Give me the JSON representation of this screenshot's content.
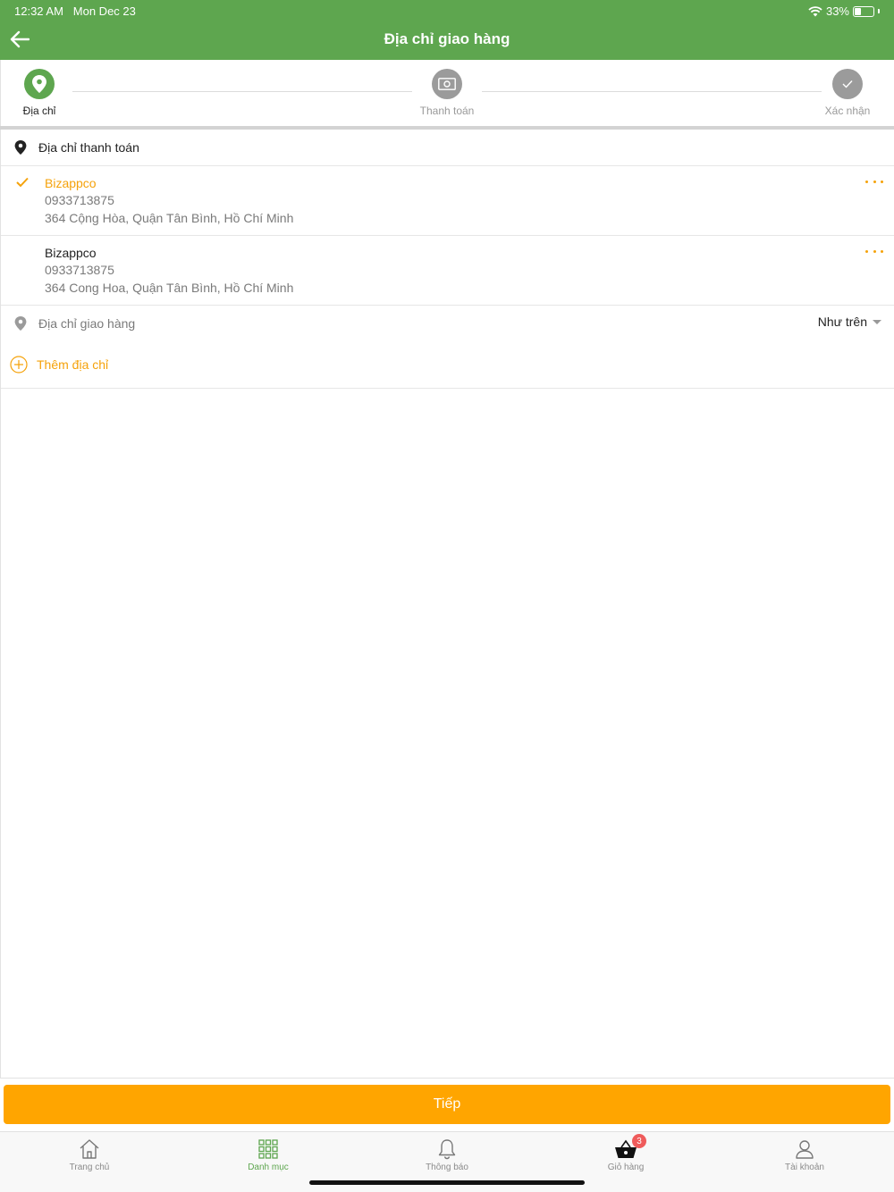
{
  "status_bar": {
    "time": "12:32 AM",
    "date": "Mon Dec 23",
    "battery": "33%",
    "wifi_icon": "wifi-icon"
  },
  "header": {
    "title": "Địa chỉ giao hàng",
    "back_icon": "arrow-left-icon"
  },
  "steps": [
    {
      "label": "Địa chỉ",
      "icon": "location-pin-icon",
      "active": true
    },
    {
      "label": "Thanh toán",
      "icon": "cash-icon",
      "active": false
    },
    {
      "label": "Xác nhận",
      "icon": "checkmark-icon",
      "active": false
    }
  ],
  "billing": {
    "title": "Địa chỉ thanh toán",
    "addresses": [
      {
        "name": "Bizappco",
        "phone": "0933713875",
        "address": "364 Cộng Hòa, Quận Tân Bình, Hồ Chí Minh",
        "selected": true
      },
      {
        "name": "Bizappco",
        "phone": "0933713875",
        "address": "364 Cong Hoa, Quận Tân Bình, Hồ Chí Minh",
        "selected": false
      }
    ]
  },
  "shipping": {
    "label": "Địa chỉ giao hàng",
    "value": "Như trên"
  },
  "add_address": {
    "label": "Thêm địa chỉ"
  },
  "next_button": {
    "label": "Tiếp"
  },
  "tabs": [
    {
      "label": "Trang chủ",
      "icon": "home-icon",
      "active": false
    },
    {
      "label": "Danh mục",
      "icon": "grid-icon",
      "active": true
    },
    {
      "label": "Thông báo",
      "icon": "bell-icon",
      "active": false
    },
    {
      "label": "Giỏ hàng",
      "icon": "basket-icon",
      "active": false,
      "badge": "3"
    },
    {
      "label": "Tài khoản",
      "icon": "user-icon",
      "active": false
    }
  ],
  "colors": {
    "brand_green": "#5ea64f",
    "accent_orange": "#ffa500",
    "badge_red": "#ef5b5b"
  }
}
